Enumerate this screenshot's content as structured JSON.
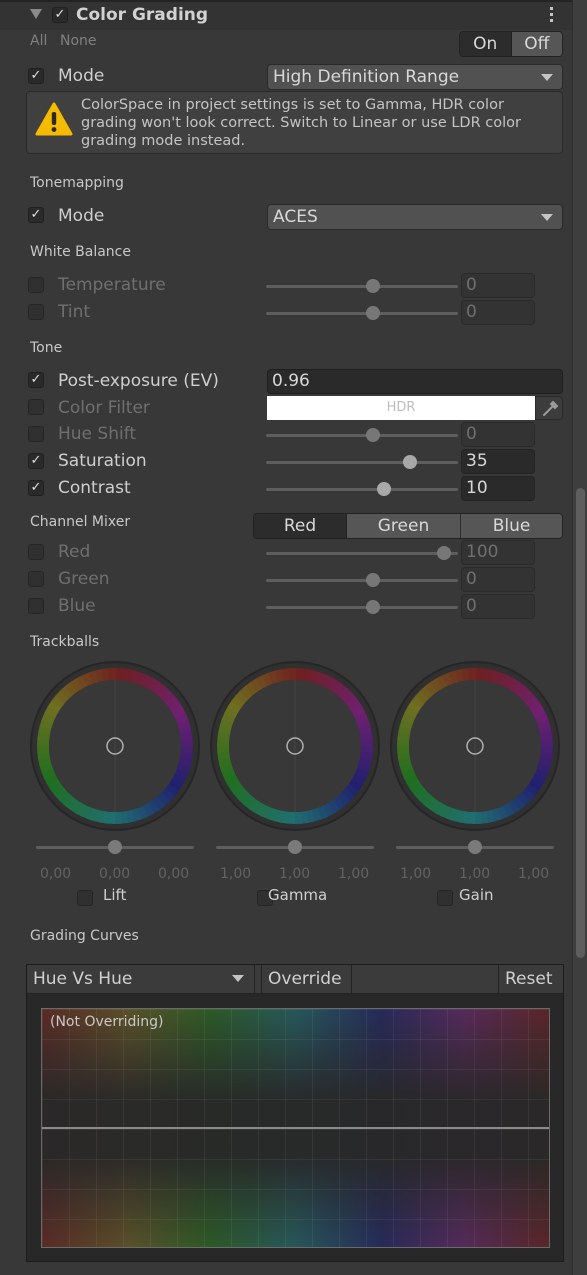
{
  "header": {
    "title": "Color Grading",
    "enabled": true
  },
  "override_links": {
    "all": "All",
    "none": "None"
  },
  "toggle": {
    "on": "On",
    "off": "Off",
    "selected": "Off"
  },
  "mode": {
    "label": "Mode",
    "checked": true,
    "value": "High Definition Range"
  },
  "warning": {
    "icon": "warning-icon",
    "text": "ColorSpace in project settings is set to Gamma, HDR color grading won't look correct. Switch to Linear or use LDR color grading mode instead."
  },
  "tonemapping": {
    "title": "Tonemapping",
    "mode_label": "Mode",
    "mode_checked": true,
    "mode_value": "ACES"
  },
  "white_balance": {
    "title": "White Balance",
    "rows": [
      {
        "label": "Temperature",
        "checked": false,
        "value": "0",
        "fraction": 0.5
      },
      {
        "label": "Tint",
        "checked": false,
        "value": "0",
        "fraction": 0.5
      }
    ]
  },
  "tone": {
    "title": "Tone",
    "post_exposure": {
      "label": "Post-exposure (EV)",
      "checked": true,
      "value": "0.96"
    },
    "color_filter": {
      "label": "Color Filter",
      "checked": false,
      "swatch": "#ffffff",
      "hdr_label": "HDR"
    },
    "rows": [
      {
        "label": "Hue Shift",
        "checked": false,
        "value": "0",
        "fraction": 0.5
      },
      {
        "label": "Saturation",
        "checked": true,
        "value": "35",
        "fraction": 0.675
      },
      {
        "label": "Contrast",
        "checked": true,
        "value": "10",
        "fraction": 0.55
      }
    ]
  },
  "channel_mixer": {
    "title": "Channel Mixer",
    "tabs": [
      "Red",
      "Green",
      "Blue"
    ],
    "selected_tab": "Red",
    "rows": [
      {
        "label": "Red",
        "checked": false,
        "value": "100",
        "fraction": 0.833
      },
      {
        "label": "Green",
        "checked": false,
        "value": "0",
        "fraction": 0.5
      },
      {
        "label": "Blue",
        "checked": false,
        "value": "0",
        "fraction": 0.5
      }
    ]
  },
  "trackballs": {
    "title": "Trackballs",
    "items": [
      {
        "label": "Lift",
        "checked": false,
        "values": [
          "0,00",
          "0,00",
          "0,00"
        ],
        "fraction": 0.5
      },
      {
        "label": "Gamma",
        "checked": false,
        "values": [
          "1,00",
          "1,00",
          "1,00"
        ],
        "fraction": 0.5
      },
      {
        "label": "Gain",
        "checked": false,
        "values": [
          "1,00",
          "1,00",
          "1,00"
        ],
        "fraction": 0.5
      }
    ]
  },
  "grading_curves": {
    "title": "Grading Curves",
    "curve_select": "Hue Vs Hue",
    "override_label": "Override",
    "reset_label": "Reset",
    "status": "(Not Overriding)"
  },
  "checkmark": "✓"
}
